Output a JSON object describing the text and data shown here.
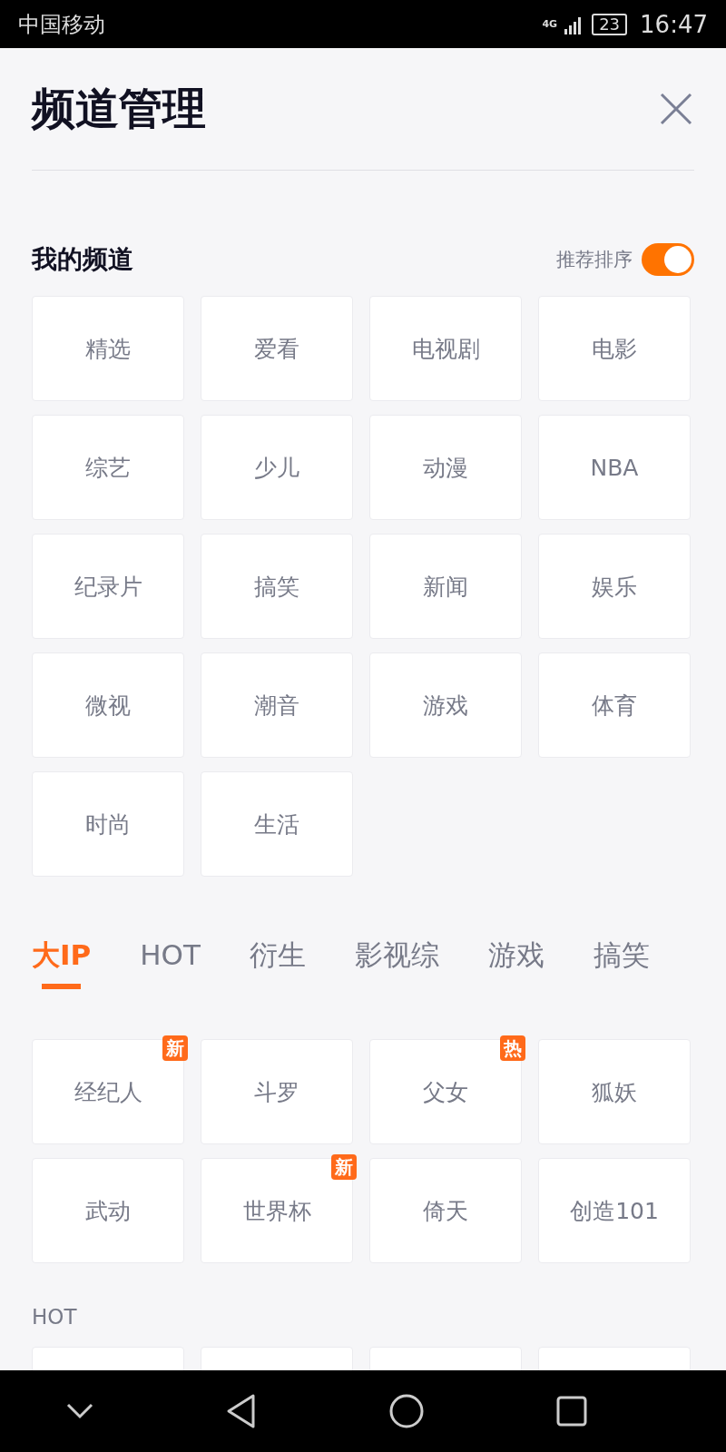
{
  "status_bar": {
    "carrier": "中国移动",
    "network": "4G",
    "battery": "23",
    "time": "16:47"
  },
  "header": {
    "title": "频道管理"
  },
  "my_channels": {
    "title": "我的频道",
    "sort_label": "推荐排序",
    "sort_on": true,
    "items": [
      {
        "label": "精选"
      },
      {
        "label": "爱看"
      },
      {
        "label": "电视剧"
      },
      {
        "label": "电影"
      },
      {
        "label": "综艺"
      },
      {
        "label": "少儿"
      },
      {
        "label": "动漫"
      },
      {
        "label": "NBA"
      },
      {
        "label": "纪录片"
      },
      {
        "label": "搞笑"
      },
      {
        "label": "新闻"
      },
      {
        "label": "娱乐"
      },
      {
        "label": "微视"
      },
      {
        "label": "潮音"
      },
      {
        "label": "游戏"
      },
      {
        "label": "体育"
      },
      {
        "label": "时尚"
      },
      {
        "label": "生活"
      }
    ]
  },
  "category_tabs": [
    {
      "label": "大IP",
      "selected": true
    },
    {
      "label": "HOT",
      "selected": false
    },
    {
      "label": "衍生",
      "selected": false
    },
    {
      "label": "影视综",
      "selected": false
    },
    {
      "label": "游戏",
      "selected": false
    },
    {
      "label": "搞笑",
      "selected": false
    }
  ],
  "ip_channels": [
    {
      "label": "经纪人",
      "badge": "新"
    },
    {
      "label": "斗罗"
    },
    {
      "label": "父女",
      "badge": "热"
    },
    {
      "label": "狐妖"
    },
    {
      "label": "武动"
    },
    {
      "label": "世界杯",
      "badge": "新"
    },
    {
      "label": "倚天"
    },
    {
      "label": "创造101"
    }
  ],
  "hot_section": {
    "title": "HOT"
  }
}
